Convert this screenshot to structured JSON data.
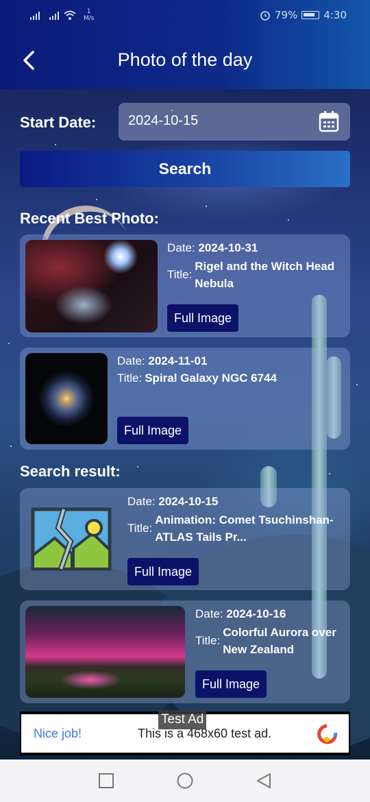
{
  "status_bar": {
    "net_speed_value": "1",
    "net_speed_unit": "M/s",
    "battery": "79%",
    "time": "4:30"
  },
  "app_bar": {
    "title": "Photo of the day"
  },
  "date_picker": {
    "label": "Start Date:",
    "value": "2024-10-15"
  },
  "search_button": "Search",
  "recent_section": {
    "title": "Recent Best Photo:",
    "items": [
      {
        "date_label": "Date:",
        "date": "2024-10-31",
        "title_label": "Title:",
        "title": "Rigel and the Witch Head Nebula",
        "button": "Full Image"
      },
      {
        "date_label": "Date:",
        "date": "2024-11-01",
        "title_label": "Title:",
        "title": "Spiral Galaxy NGC 6744",
        "button": "Full Image"
      }
    ]
  },
  "results_section": {
    "title": "Search result:",
    "items": [
      {
        "date_label": "Date:",
        "date": "2024-10-15",
        "title_label": "Title:",
        "title": "Animation: Comet Tsuchinshan-ATLAS Tails Pr...",
        "button": "Full Image"
      },
      {
        "date_label": "Date:",
        "date": "2024-10-16",
        "title_label": "Title:",
        "title": "Colorful Aurora over New Zealand",
        "button": "Full Image"
      }
    ]
  },
  "ad": {
    "label": "Test Ad",
    "headline": "Nice job!",
    "text": "This is a 468x60 test ad."
  },
  "colors": {
    "app_bar": "#0d2a8a",
    "button_dark": "#0c1268",
    "ad_link": "#3b7be0"
  }
}
